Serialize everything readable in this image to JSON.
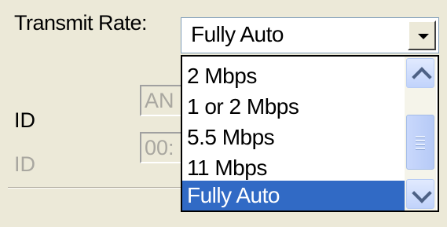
{
  "transmit": {
    "label": "Transmit Rate:",
    "selected_value": "Fully Auto",
    "options": [
      "2 Mbps",
      "1 or 2 Mbps",
      "5.5 Mbps",
      "11 Mbps",
      "Fully Auto"
    ],
    "selected_index": 4
  },
  "fields": {
    "id1_label": "ID",
    "id1_value": "AN",
    "id2_label": "ID",
    "id2_value": "00:"
  },
  "colors": {
    "window_bg": "#ECE9D8",
    "selection_bg": "#316AC5",
    "disabled_text": "#A9A7A0"
  }
}
